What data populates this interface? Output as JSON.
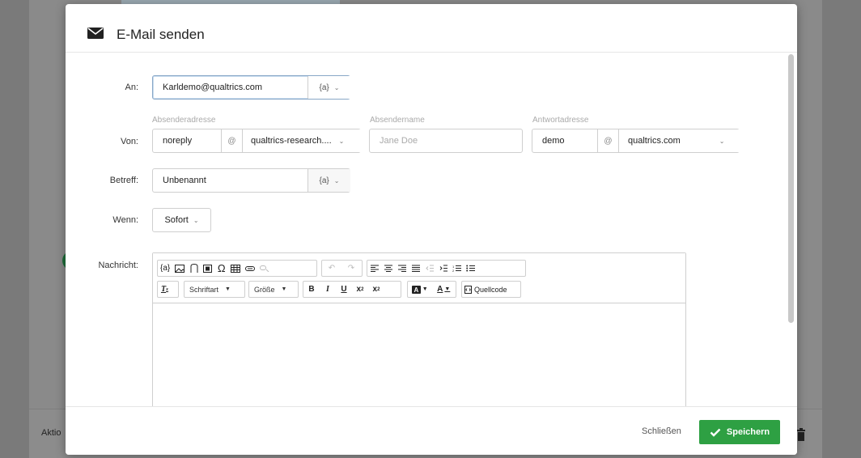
{
  "background": {
    "footer_label": "Aktio"
  },
  "modal": {
    "title": "E-Mail senden",
    "title_icon": "envelope-icon"
  },
  "form": {
    "to": {
      "label": "An:",
      "value": "Karldemo@qualtrics.com",
      "piped_text": "{a}"
    },
    "from": {
      "label": "Von:",
      "sender_address_label": "Absenderadresse",
      "sender_address_local": "noreply",
      "at_sign": "@",
      "sender_domain": "qualtrics-research....",
      "sender_name_label": "Absendername",
      "sender_name_placeholder": "Jane Doe",
      "reply_to_label": "Antwortadresse",
      "reply_to_local": "demo",
      "reply_to_at": "@",
      "reply_to_domain": "qualtrics.com"
    },
    "subject": {
      "label": "Betreff:",
      "value": "Unbenannt",
      "piped_text": "{a}"
    },
    "when": {
      "label": "Wenn:",
      "value": "Sofort"
    },
    "message": {
      "label": "Nachricht:"
    }
  },
  "editor": {
    "font_combo": "Schriftart",
    "size_combo": "Größe",
    "source_label": "Quellcode",
    "piped_text_btn": "{a}"
  },
  "footer": {
    "close_label": "Schließen",
    "save_label": "Speichern"
  },
  "colors": {
    "save_green": "#2ea043",
    "focus_border": "#88a7c7"
  }
}
